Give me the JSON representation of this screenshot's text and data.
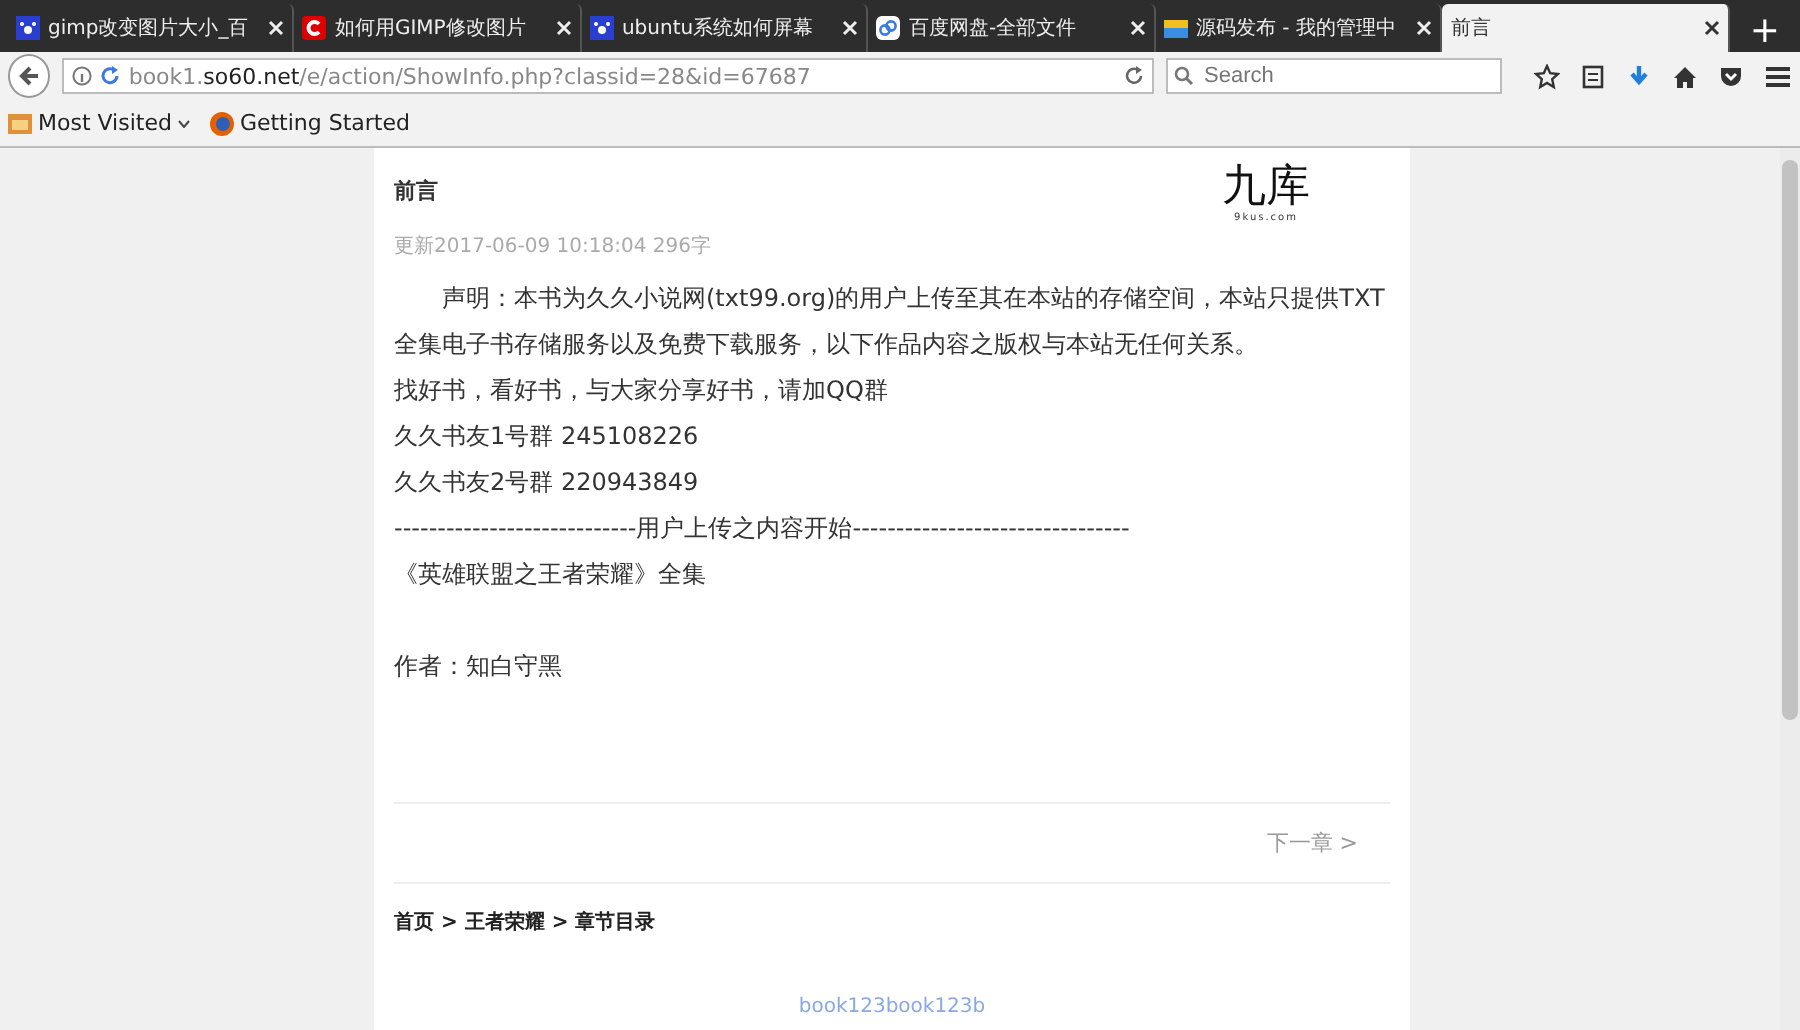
{
  "tabs": [
    {
      "title": "gimp改变图片大小_百",
      "selected": false
    },
    {
      "title": "如何用GIMP修改图片",
      "selected": false
    },
    {
      "title": "ubuntu系统如何屏幕",
      "selected": false
    },
    {
      "title": "百度网盘-全部文件",
      "selected": false
    },
    {
      "title": "源码发布 - 我的管理中",
      "selected": false
    },
    {
      "title": "前言",
      "selected": true
    }
  ],
  "new_tab": "+",
  "address": {
    "prefix": "book1.",
    "domain": "so60.net",
    "path": "/e/action/ShowInfo.php?classid=28&id=67687"
  },
  "search": {
    "placeholder": "Search"
  },
  "bookmarks": [
    {
      "label": "Most Visited",
      "kind": "folder"
    },
    {
      "label": "Getting Started",
      "kind": "firefox"
    }
  ],
  "article": {
    "title": "前言",
    "logo": {
      "name": "九库",
      "domain": "9kus.com"
    },
    "meta": "更新2017-06-09 10:18:04  296字",
    "lines": [
      {
        "kind": "indent",
        "text": "声明：本书为久久小说网(txt99.org)的用户上传至其在本站的存储空间，本站只提供TXT全集电子书存储服务以及免费下载服务，以下作品内容之版权与本站无任何关系。"
      },
      {
        "kind": "line",
        "text": "找好书，看好书，与大家分享好书，请加QQ群"
      },
      {
        "kind": "line",
        "text": "久久书友1号群 245108226"
      },
      {
        "kind": "line",
        "text": "久久书友2号群 220943849"
      },
      {
        "kind": "line",
        "text": "----------------------------用户上传之内容开始--------------------------------"
      },
      {
        "kind": "line",
        "text": "《英雄联盟之王者荣耀》全集"
      },
      {
        "kind": "spaced",
        "text": "作者：知白守黑"
      }
    ],
    "next": "下一章 >",
    "breadcrumb": "首页 > 王者荣耀 > 章节目录",
    "footer": "book123book123b"
  }
}
